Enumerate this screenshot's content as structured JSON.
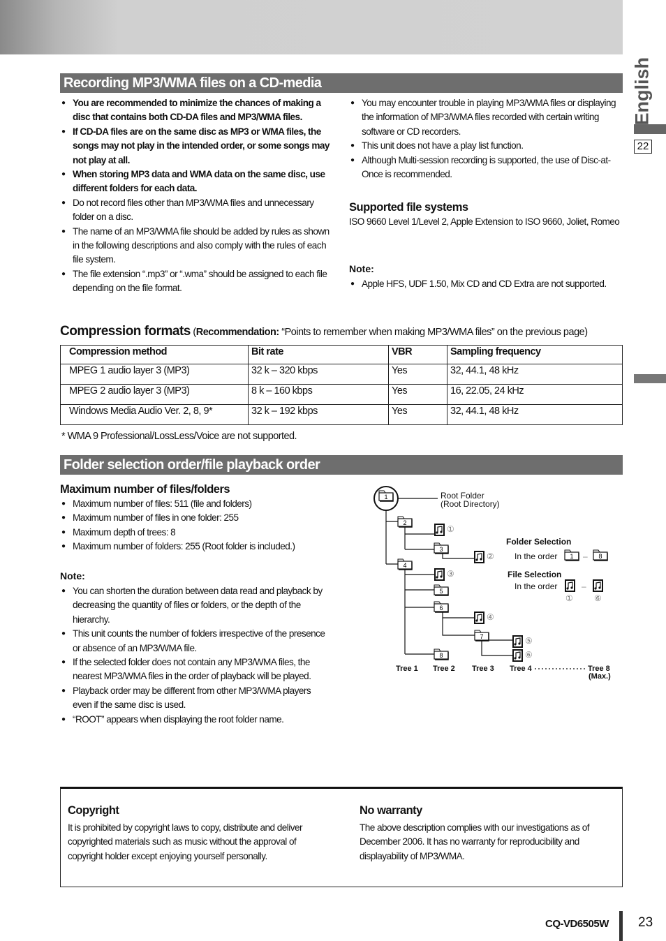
{
  "sidebar": {
    "language": "English",
    "prev_page": "22"
  },
  "section1": {
    "title": "Recording MP3/WMA files on a CD-media",
    "left_bold": [
      "You are recommended to minimize the chances of making a disc that contains both CD-DA files and MP3/WMA files.",
      "If CD-DA files are on the same disc as MP3 or WMA files, the songs may not play in the intended order, or some songs may not play at all.",
      "When storing MP3 data and WMA data on the same disc, use different folders for each data."
    ],
    "left": [
      "Do not record files other than MP3/WMA files and unnecessary folder on a disc.",
      "The name of an MP3/WMA file should be added by rules as shown in the following descriptions and also comply with the rules of each file system.",
      "The file extension “.mp3” or “.wma” should be assigned to each file depending on the file format."
    ],
    "right": [
      "You may encounter trouble in playing MP3/WMA files or displaying the information of MP3/WMA files recorded with certain writing software or CD recorders.",
      "This unit does not have a play list function.",
      "Although Multi-session recording is supported, the use of Disc-at-Once is recommended."
    ],
    "fs_title": "Supported file systems",
    "fs_text": "ISO 9660 Level 1/Level 2, Apple Extension to ISO 9660, Joliet, Romeo",
    "note_label": "Note:",
    "note_items": [
      "Apple HFS, UDF 1.50, Mix CD and CD Extra are not supported."
    ]
  },
  "compression": {
    "title": "Compression formats",
    "rec_label": "Recommendation:",
    "rec_text": "“Points to remember when making MP3/WMA files” on the previous page)",
    "headers": [
      "Compression method",
      "Bit rate",
      "VBR",
      "Sampling frequency"
    ],
    "rows": [
      [
        "MPEG 1 audio layer 3 (MP3)",
        "32 k – 320 kbps",
        "Yes",
        "32, 44.1, 48 kHz"
      ],
      [
        "MPEG 2 audio layer 3 (MP3)",
        "8 k – 160 kbps",
        "Yes",
        "16, 22.05, 24 kHz"
      ],
      [
        "Windows Media Audio Ver. 2, 8, 9*",
        "32 k – 192 kbps",
        "Yes",
        "32, 44.1, 48 kHz"
      ]
    ],
    "footnote": "* WMA 9 Professional/LossLess/Voice are not supported."
  },
  "section2": {
    "title": "Folder selection order/file playback order",
    "max_title": "Maximum number of files/folders",
    "max_items": [
      "Maximum number of files: 511 (file and folders)",
      "Maximum number of files in one folder: 255",
      "Maximum depth of trees: 8",
      "Maximum number of folders: 255 (Root folder is included.)"
    ],
    "note_label": "Note:",
    "note_items": [
      "You can shorten the duration between data read and playback by decreasing the quantity of files or folders, or the depth of the hierarchy.",
      "This unit counts the number of folders irrespective of the presence or absence of an MP3/WMA file.",
      "If the selected folder does not contain any MP3/WMA files, the nearest MP3/WMA files in the order of playback will be played.",
      "Playback order may be different from other MP3/WMA players even if the same disc is used.",
      "“ROOT” appears when displaying the root folder name."
    ]
  },
  "diagram": {
    "root1": "Root Folder",
    "root2": "(Root Directory)",
    "folders": [
      "1",
      "2",
      "3",
      "4",
      "5",
      "6",
      "7",
      "8"
    ],
    "files": [
      "①",
      "②",
      "③",
      "④",
      "⑤",
      "⑥"
    ],
    "folder_sel": "Folder Selection",
    "file_sel": "File Selection",
    "in_order": "In the order",
    "dash": "–",
    "trees": [
      "Tree 1",
      "Tree 2",
      "Tree 3",
      "Tree 4",
      "Tree 8"
    ],
    "max": "(Max.)"
  },
  "copyright": {
    "title": "Copyright",
    "text": "It is prohibited by copyright laws to copy, distribute and deliver copyrighted materials such as music without the approval of copyright holder except enjoying yourself personally."
  },
  "warranty": {
    "title": "No warranty",
    "text": "The above description complies with our investigations as of December 2006. It has no warranty for reproducibility and displayability of MP3/WMA."
  },
  "footer": {
    "model": "CQ-VD6505W",
    "page": "23"
  }
}
